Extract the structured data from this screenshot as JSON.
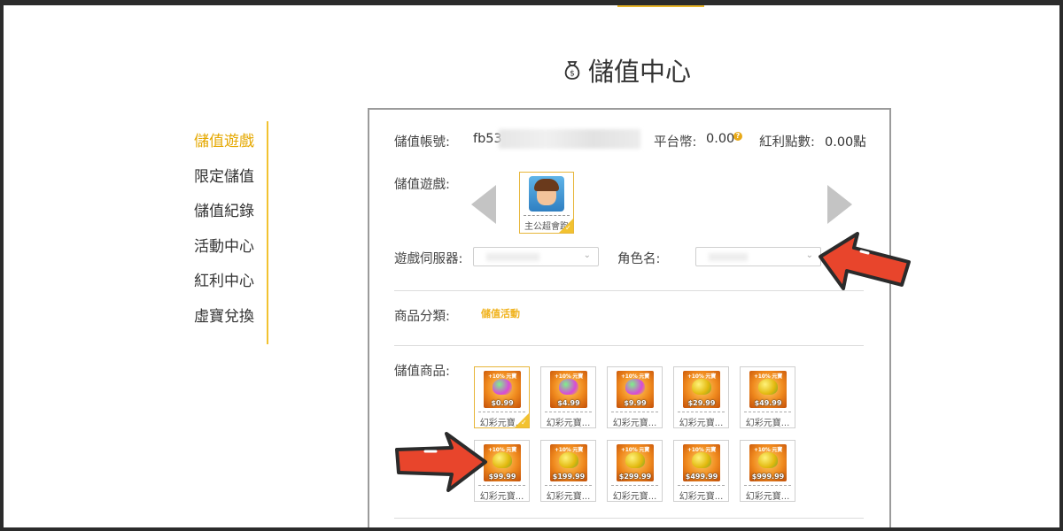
{
  "page": {
    "title": "儲值中心",
    "title_icon": "money-bag-icon"
  },
  "sidebar": {
    "items": [
      {
        "label": "儲值遊戲",
        "active": true
      },
      {
        "label": "限定儲值",
        "active": false
      },
      {
        "label": "儲值紀錄",
        "active": false
      },
      {
        "label": "活動中心",
        "active": false
      },
      {
        "label": "紅利中心",
        "active": false
      },
      {
        "label": "虛寶兌換",
        "active": false
      }
    ]
  },
  "account": {
    "label": "儲值帳號:",
    "value": "fb53",
    "platform_coin_label": "平台幣:",
    "platform_coin_value": "0.00",
    "bonus_label": "紅利點數:",
    "bonus_value": "0.00點"
  },
  "game": {
    "label": "儲值遊戲:",
    "selected_name": "主公超會跑"
  },
  "server": {
    "label": "遊戲伺服器:",
    "role_label": "角色名:"
  },
  "category": {
    "label": "商品分類:",
    "tab": "儲值活動"
  },
  "products": {
    "label": "儲值商品:",
    "items": [
      {
        "name": "幻彩元寶...",
        "price": "$0.99",
        "bonus": "+10% 元寶",
        "gem": "c1",
        "selected": true
      },
      {
        "name": "幻彩元寶...",
        "price": "$4.99",
        "bonus": "+10% 元寶",
        "gem": "c1",
        "selected": false
      },
      {
        "name": "幻彩元寶...",
        "price": "$9.99",
        "bonus": "+10% 元寶",
        "gem": "c1",
        "selected": false
      },
      {
        "name": "幻彩元寶...",
        "price": "$29.99",
        "bonus": "+10% 元寶",
        "gem": "c2",
        "selected": false
      },
      {
        "name": "幻彩元寶...",
        "price": "$49.99",
        "bonus": "+10% 元寶",
        "gem": "c2",
        "selected": false
      },
      {
        "name": "幻彩元寶...",
        "price": "$99.99",
        "bonus": "+10% 元寶",
        "gem": "c2",
        "selected": false
      },
      {
        "name": "幻彩元寶...",
        "price": "$199.99",
        "bonus": "+10% 元寶",
        "gem": "c2",
        "selected": false
      },
      {
        "name": "幻彩元寶...",
        "price": "$299.99",
        "bonus": "+10% 元寶",
        "gem": "c2",
        "selected": false
      },
      {
        "name": "幻彩元寶...",
        "price": "$499.99",
        "bonus": "+10% 元寶",
        "gem": "c2",
        "selected": false
      },
      {
        "name": "幻彩元寶...",
        "price": "$999.99",
        "bonus": "+10% 元寶",
        "gem": "c2",
        "selected": false
      }
    ]
  },
  "colors": {
    "accent": "#f2c230",
    "active_text": "#e5a800",
    "annotation_arrow": "#e8452c"
  }
}
